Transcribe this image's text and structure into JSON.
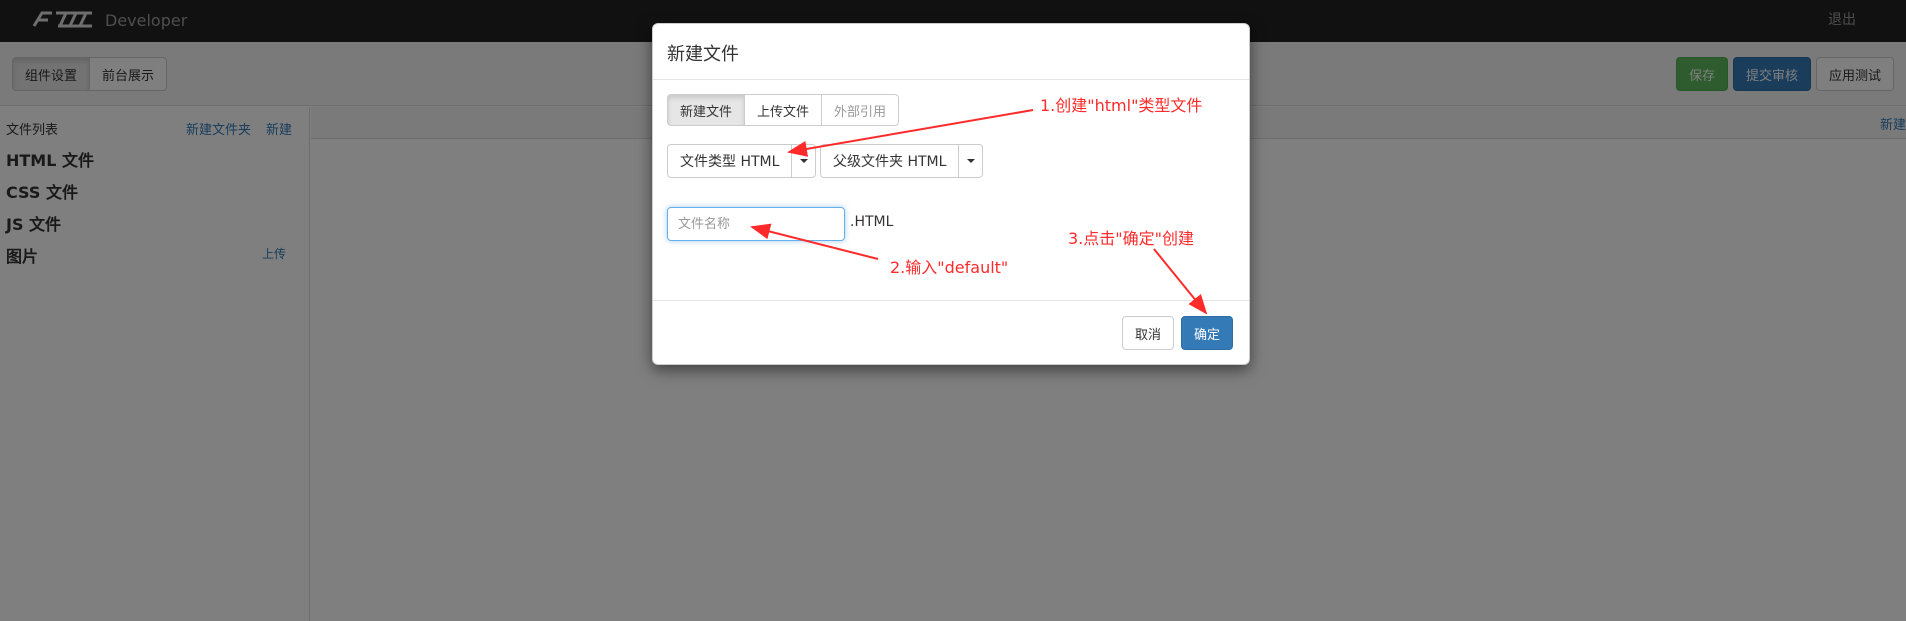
{
  "navbar": {
    "brand": "Developer",
    "logout": "退出"
  },
  "toolbar": {
    "tabs": [
      {
        "label": "组件设置"
      },
      {
        "label": "前台展示"
      }
    ],
    "save": "保存",
    "submit": "提交审核",
    "test": "应用测试"
  },
  "sidebar": {
    "header": "文件列表",
    "new_folder": "新建文件夹",
    "new": "新建",
    "categories": [
      "HTML 文件",
      "CSS 文件",
      "JS 文件",
      "图片"
    ],
    "upload": "上传"
  },
  "main": {
    "new": "新建"
  },
  "modal": {
    "title": "新建文件",
    "tabs": [
      {
        "label": "新建文件"
      },
      {
        "label": "上传文件"
      },
      {
        "label": "外部引用"
      }
    ],
    "file_type": "文件类型 HTML",
    "parent_folder": "父级文件夹 HTML",
    "name_placeholder": "文件名称",
    "suffix": ".HTML",
    "cancel": "取消",
    "ok": "确定"
  },
  "annotations": {
    "step1": "1.创建\"html\"类型文件",
    "step2": "2.输入\"default\"",
    "step3": "3.点击\"确定\"创建"
  },
  "colors": {
    "annotation": "#ff2b2b",
    "primary": "#337ab7",
    "success": "#5cb85c",
    "navbar": "#222222"
  }
}
